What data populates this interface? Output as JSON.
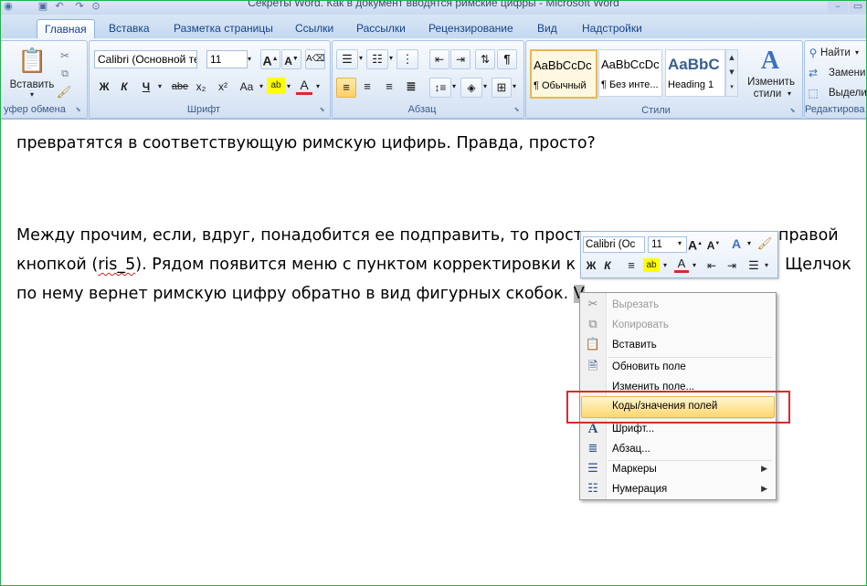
{
  "window": {
    "title": "Секреты Word. Как в документ вводятся римские цифры - Microsoft Word"
  },
  "tabs": [
    {
      "label": "Главная"
    },
    {
      "label": "Вставка"
    },
    {
      "label": "Разметка страницы"
    },
    {
      "label": "Ссылки"
    },
    {
      "label": "Рассылки"
    },
    {
      "label": "Рецензирование"
    },
    {
      "label": "Вид"
    },
    {
      "label": "Надстройки"
    }
  ],
  "ribbon": {
    "clipboard": {
      "label": "уфер обмена",
      "paste_label": "Вставить"
    },
    "font": {
      "label": "Шрифт",
      "font_name": "Calibri (Основной те",
      "font_size": "11",
      "bold": "Ж",
      "italic": "К",
      "underline": "Ч",
      "strike": "abe",
      "sub": "x₂",
      "sup": "x²",
      "case": "Aa"
    },
    "paragraph": {
      "label": "Абзац"
    },
    "styles": {
      "label": "Стили",
      "items": [
        {
          "sample": "AaBbCcDc",
          "name": "¶ Обычный"
        },
        {
          "sample": "AaBbCcDc",
          "name": "¶ Без инте..."
        },
        {
          "sample": "AaBbC",
          "name": "Heading 1"
        }
      ],
      "change_label_1": "Изменить",
      "change_label_2": "стили"
    },
    "editing": {
      "label": "Редактирова",
      "find": "Найти",
      "replace": "Замени",
      "select": "Выдели"
    }
  },
  "document": {
    "line1": "превратятся в соответствующую римскую цифирь. Правда, просто?",
    "line2a": "Между прочим, если, вдруг, понадобится ее подправить, то прост",
    "line2b": "правой",
    "line3a": "кнопкой (",
    "line3b": "ris_5",
    "line3c": "). Рядом появится меню с пунктом корректировки к",
    "line3d": ". Щелчок",
    "line4a": "по нему вернет римскую цифру обратно в вид фигурных скобок. ",
    "line4b": "V"
  },
  "mini_toolbar": {
    "font_name": "Calibri (Ос",
    "font_size": "11",
    "bold": "Ж",
    "italic": "К"
  },
  "context_menu": {
    "items": [
      {
        "label": "Вырезать",
        "icon": "scissors-icon",
        "disabled": true
      },
      {
        "label": "Копировать",
        "icon": "copy-icon",
        "disabled": true
      },
      {
        "label": "Вставить",
        "icon": "paste-icon",
        "disabled": false
      },
      {
        "label": "Обновить поле",
        "icon": "update-field-icon",
        "disabled": false
      },
      {
        "label": "Изменить поле...",
        "icon": "",
        "disabled": false
      },
      {
        "label": "Коды/значения полей",
        "icon": "",
        "disabled": false
      },
      {
        "label": "Шрифт...",
        "icon": "font-icon",
        "disabled": false
      },
      {
        "label": "Абзац...",
        "icon": "paragraph-icon",
        "disabled": false
      },
      {
        "label": "Маркеры",
        "icon": "bullets-icon",
        "disabled": false
      },
      {
        "label": "Нумерация",
        "icon": "numbering-icon",
        "disabled": false
      }
    ]
  },
  "colors": {
    "highlight_box": "#d62b2b",
    "accent": "#15428b",
    "menu_hover": "#ffd76f"
  }
}
